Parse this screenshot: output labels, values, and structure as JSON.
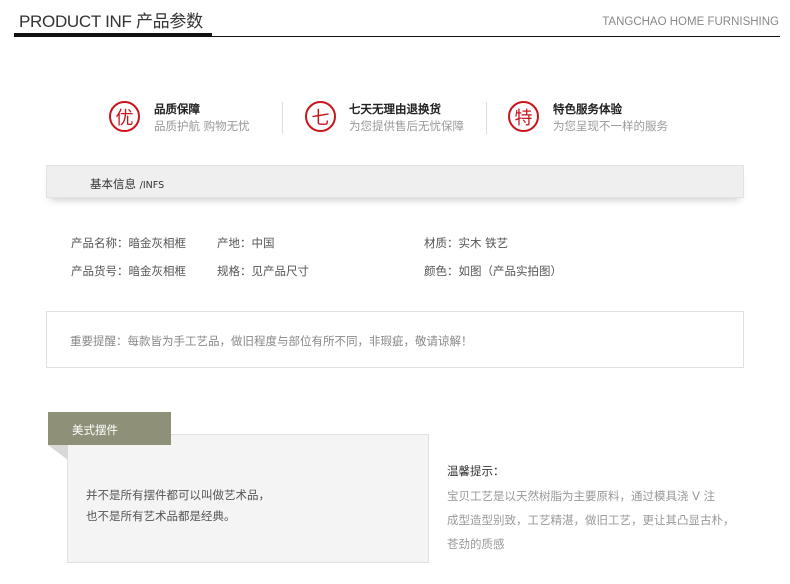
{
  "header": {
    "title": "PRODUCT INF 产品参数",
    "brand": "TANGCHAO HOME FURNISHING"
  },
  "features": [
    {
      "icon_char": "优",
      "title": "品质保障",
      "subtitle": "品质护航 购物无忧"
    },
    {
      "icon_char": "七",
      "title": "七天无理由退换货",
      "subtitle": "为您提供售后无忧保障"
    },
    {
      "icon_char": "特",
      "title": "特色服务体验",
      "subtitle": "为您呈现不一样的服务"
    }
  ],
  "info_bar": {
    "title": "基本信息",
    "suffix": "/INFS"
  },
  "info": {
    "name": "产品名称：暗金灰相框",
    "origin": "产地：中国",
    "material": "材质：实木  铁艺",
    "sku": "产品货号：暗金灰相框",
    "size": "规格：见产品尺寸",
    "color": "颜色：如图（产品实拍图）"
  },
  "notice": "重要提醒：每款皆为手工艺品，做旧程度与部位有所不同，非瑕疵，敬请谅解！",
  "style_section": {
    "tag": "美式摆件",
    "line1": "并不是所有摆件都可以叫做艺术品，",
    "line2": "也不是所有艺术品都是经典。"
  },
  "tips": {
    "title": "温馨提示：",
    "lines": [
      "宝贝工艺是以天然树脂为主要原料，通过模具浇 V 注",
      "成型造型别致，工艺精湛，做旧工艺，更让其凸显古朴，",
      "苍劲的质感"
    ]
  },
  "colors": {
    "accent_red": "#c9161c",
    "tag_green": "#8e9178"
  }
}
